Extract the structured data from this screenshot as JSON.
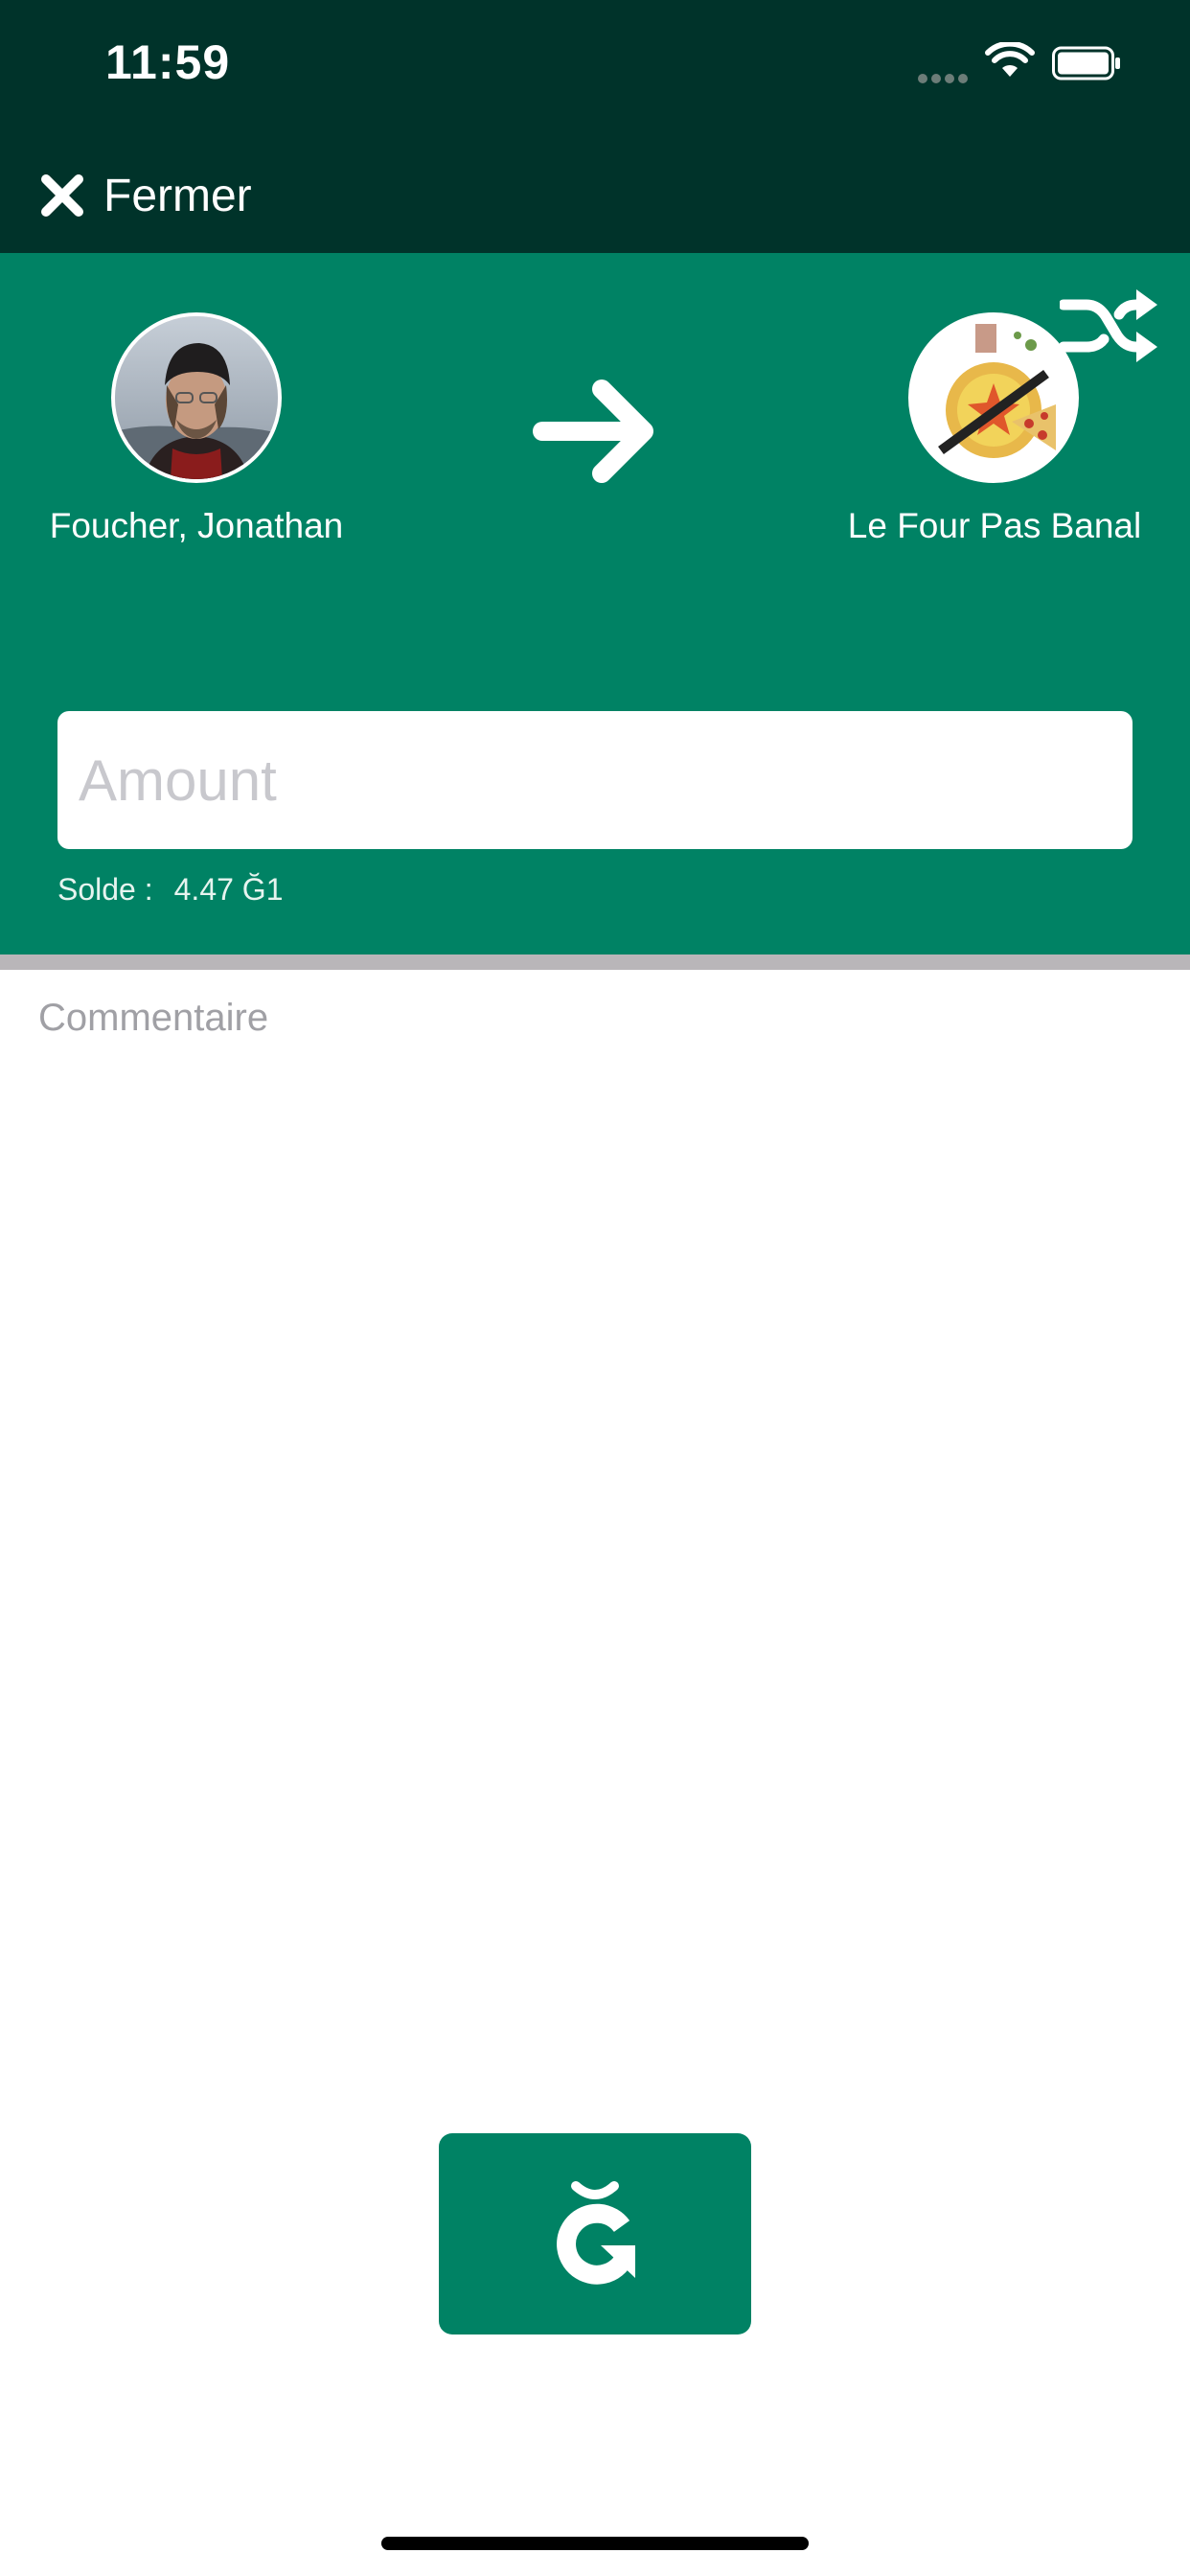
{
  "status_bar": {
    "time": "11:59",
    "icons": [
      "cellular-signal-icon",
      "wifi-icon",
      "battery-icon"
    ]
  },
  "nav": {
    "close_label": "Fermer",
    "close_icon": "close-x-icon"
  },
  "transfer": {
    "from_name": "Foucher, Jonathan",
    "to_name": "Le Four Pas Banal",
    "direction_icon": "arrow-right-icon",
    "swap_icon": "shuffle-icon"
  },
  "amount": {
    "placeholder": "Amount",
    "value": ""
  },
  "balance": {
    "label": "Solde :",
    "value": "4.47 Ğ1"
  },
  "comment": {
    "placeholder": "Commentaire",
    "value": ""
  },
  "send_button": {
    "icon": "g1-currency-icon"
  },
  "colors": {
    "nav_background": "#00332a",
    "accent_green": "#008264",
    "divider": "#b9b6b9",
    "placeholder": "#c8c8cd"
  }
}
